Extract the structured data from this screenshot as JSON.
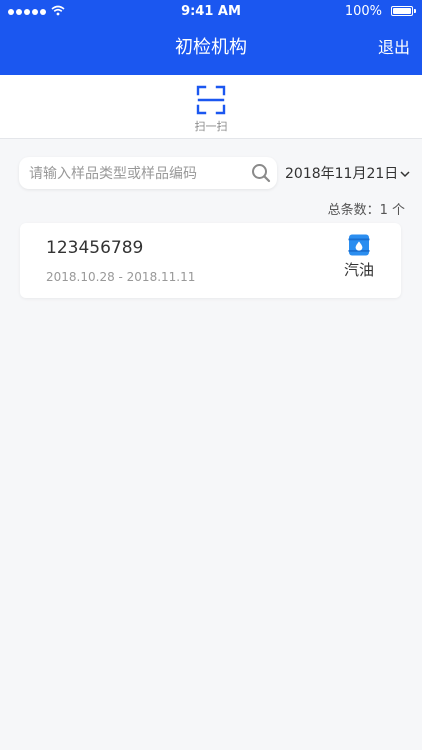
{
  "status_bar": {
    "time": "9:41 AM",
    "battery": "100%"
  },
  "nav": {
    "title": "初检机构",
    "logout_label": "退出"
  },
  "scan": {
    "label": "扫一扫",
    "icon": "scan-icon"
  },
  "filter": {
    "search_placeholder": "请输入样品类型或样品编码",
    "search_value": "",
    "date": "2018年11月21日",
    "total": "总条数：1 个"
  },
  "samples": [
    {
      "code": "123456789",
      "dates": "2018.10.28 - 2018.11.11",
      "type": "汽油",
      "icon": "oil-barrel-icon"
    }
  ],
  "colors": {
    "brand_blue": "#1b57f0",
    "icon_blue": "#2b8ef0"
  }
}
